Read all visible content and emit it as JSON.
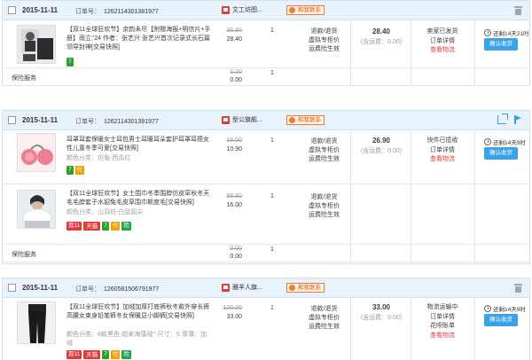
{
  "orders": [
    {
      "date": "2015-11-11",
      "order_no_label": "订单号：",
      "order_no": "1262114301381977",
      "shop": "文工坊图...",
      "contact": "和我联系",
      "items": [
        {
          "name": "【双11全球狂欢节】余韵未尽【附赠海报+明信片+手册】雨立:'24 作者：张艺兴 张艺兴首次记录式长石篇 领导封神[交易快照]",
          "attr": "",
          "tags": [
            "7"
          ],
          "old_price": "36.80",
          "price": "28.40",
          "qty": "1",
          "service": [
            "退款/退货",
            "虚拟专柜价",
            "运费险生效"
          ]
        }
      ],
      "insurance": {
        "label": "保险服务",
        "old_price": "0.00",
        "price": "0.00",
        "qty": "1"
      },
      "total": "28.40",
      "total_sub": "(含运费：0.00)",
      "status": [
        "卖家已发货",
        "订单详情"
      ],
      "status_link": "查看物流",
      "timer": "还剩14天21时",
      "button": "确认收货"
    },
    {
      "date": "2015-11-11",
      "order_no_label": "订单号：",
      "order_no": "1262114301391977",
      "shop": "型公旗舰...",
      "contact": "和我联系",
      "items": [
        {
          "name": "耳罩耳套保暖女士耳包男士耳暖耳朵套护耳罩耳捂女性儿童冬季可爱[交易快照]",
          "attr": "颜色分类：仿兔-西瓜红",
          "tags": [
            "7",
            "付"
          ],
          "old_price": "16.00",
          "price": "10.90",
          "qty": "1",
          "service": [
            "退款/退货",
            "虚拟专柜价",
            "运费险生效"
          ]
        },
        {
          "name": "【双11全球狂欢节】女士围巾冬季围脖仿皮草秋冬天毛毛脖套子水貂兔毛皮草围巾斯度毛[交易快照]",
          "attr": "颜色分类：山羽仿-白鼠貂尖",
          "tags": [
            "双11",
            "天猫",
            "7",
            "付",
            "险"
          ],
          "old_price": "56.80",
          "price": "16.00",
          "qty": "1",
          "service": [
            "退款/退货",
            "虚拟专柜价",
            "运费险生效"
          ]
        }
      ],
      "insurance": {
        "label": "保险服务",
        "old_price": "0.00",
        "price": "0.00",
        "qty": "1"
      },
      "total": "26.90",
      "total_sub": "(含运费：0.00)",
      "status": [
        "快件已揽收",
        "订单详情"
      ],
      "status_link": "查看物流",
      "timer": "还剩14天9时",
      "button": "确认收货"
    },
    {
      "date": "2015-11-11",
      "order_no_label": "订单号：",
      "order_no": "1260581506791977",
      "shop": "雅羊人旗...",
      "contact": "和我联系",
      "items": [
        {
          "name": "【双11全球狂欢节】加绒加厚打底裤秋冬款外穿长裤高腰女束身铅笔裤冬女保暖显小脚裤[交易快照]",
          "attr": "颜色分类：8款黑色-超柔海藻绒^ 尺寸：S 厚薄：加绒",
          "tags": [
            "双11",
            "天猫",
            "7",
            "付",
            "险"
          ],
          "old_price": "100.00",
          "price": "33.00",
          "qty": "1",
          "service": [
            "退款/退货",
            "虚拟专柜价",
            "运费险生效"
          ]
        }
      ],
      "total": "33.00",
      "total_sub": "(含运费：0.00)",
      "status": [
        "物流运输中",
        "订单详情",
        "花呗账单"
      ],
      "status_link": "查看物流",
      "timer": "还剩14天9时",
      "button": "确认收货"
    }
  ],
  "colors": {
    "accent": "#3aa3e8",
    "price_red": "#e4393c",
    "header_bg": "#e8f2fb"
  }
}
